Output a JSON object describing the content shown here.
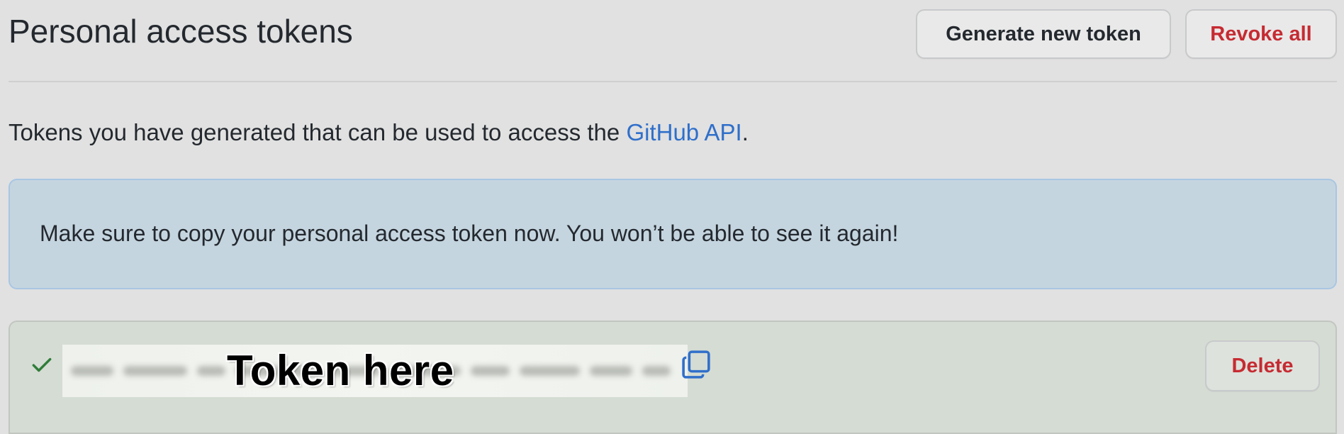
{
  "header": {
    "title": "Personal access tokens",
    "generate_label": "Generate new token",
    "revoke_label": "Revoke all"
  },
  "intro": {
    "text_before": "Tokens you have generated that can be used to access the ",
    "link_text": "GitHub API",
    "text_after": "."
  },
  "flash": {
    "message": "Make sure to copy your personal access token now. You won’t be able to see it again!"
  },
  "token": {
    "label": "Token here",
    "delete_label": "Delete",
    "icons": [
      "check-icon",
      "copy-icon"
    ]
  },
  "colors": {
    "danger": "#c62b32",
    "link": "#2f6fca",
    "flash_bg": "#c5d5df",
    "flash_border": "#a8c6e3",
    "success_bg": "#d5dcd3",
    "check": "#2f7d3a"
  }
}
